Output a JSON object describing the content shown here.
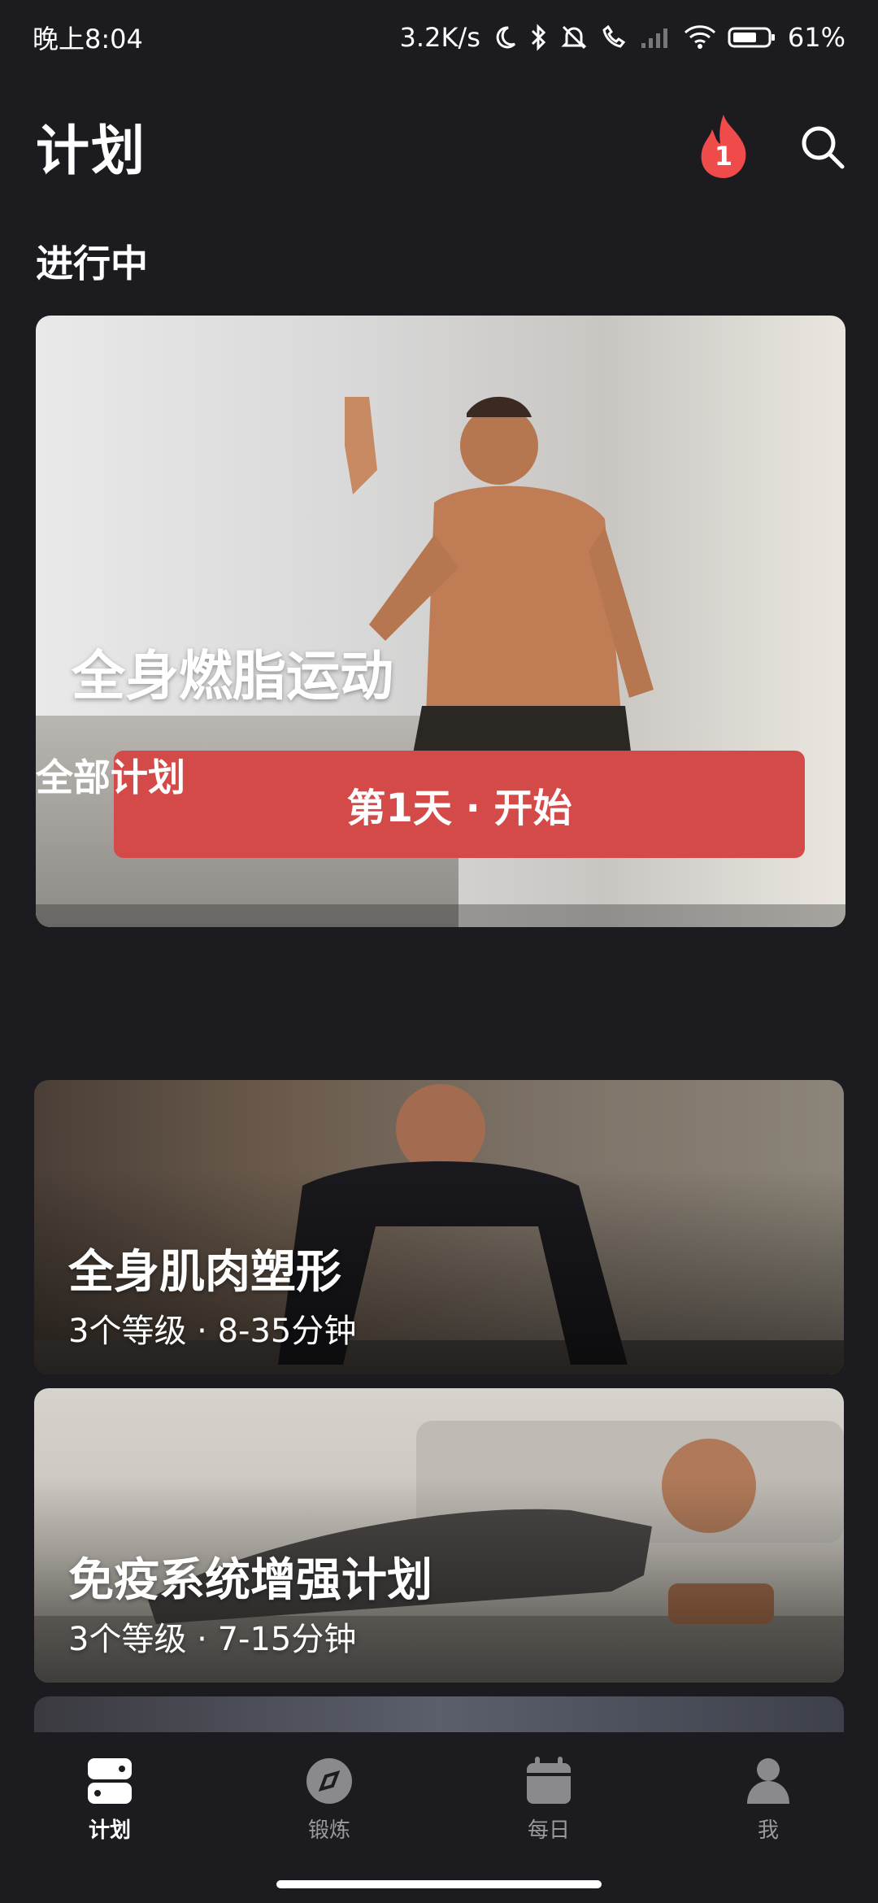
{
  "status_bar": {
    "time": "晚上8:04",
    "network_speed": "3.2K/s",
    "battery": "61%"
  },
  "header": {
    "title": "计划",
    "streak_count": "1",
    "icons": [
      "fire-icon",
      "search-icon"
    ]
  },
  "in_progress": {
    "section_title": "进行中",
    "plan_title": "全身燃脂运动",
    "start_label": "第1天 · 开始"
  },
  "all_plans": {
    "section_title": "全部计划",
    "items": [
      {
        "title": "全身肌肉塑形",
        "meta": "3个等级 · 8-35分钟"
      },
      {
        "title": "免疫系统增强计划",
        "meta": "3个等级 · 7-15分钟"
      }
    ]
  },
  "bottom_nav": {
    "items": [
      {
        "label": "计划",
        "icon": "plan-icon",
        "active": true
      },
      {
        "label": "锻炼",
        "icon": "compass-icon",
        "active": false
      },
      {
        "label": "每日",
        "icon": "calendar-icon",
        "active": false
      },
      {
        "label": "我",
        "icon": "person-icon",
        "active": false
      }
    ]
  },
  "colors": {
    "background": "#1c1b1f",
    "accent": "#d34a48",
    "fire": "#ef4b4b"
  }
}
